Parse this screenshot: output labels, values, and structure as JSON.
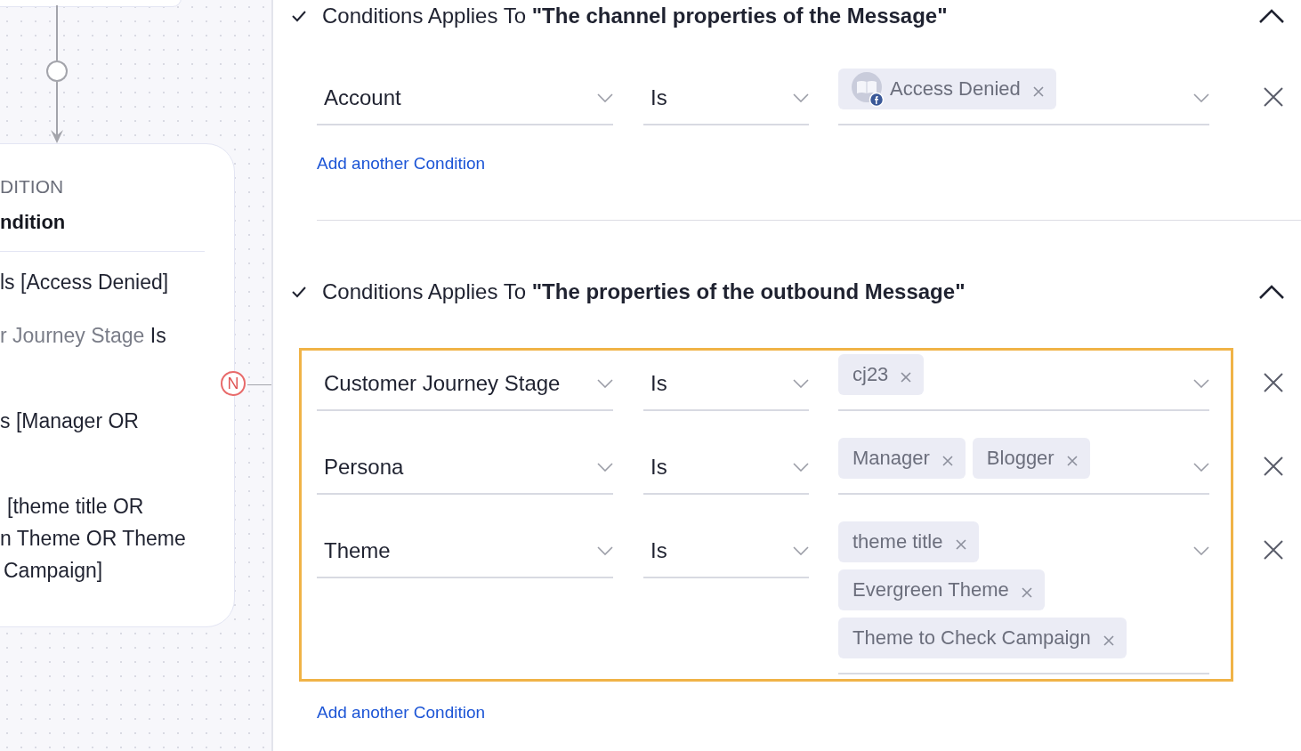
{
  "canvas": {
    "card": {
      "type_label": "DITION",
      "title": "ndition",
      "lines": [
        {
          "text": "ls [Access Denied]"
        },
        {
          "text": "r Journey Stage",
          "value": "Is"
        },
        {
          "text": "s [Manager OR"
        },
        {
          "text": "[theme title OR"
        },
        {
          "text": "n Theme OR Theme"
        },
        {
          "text": "Campaign]"
        }
      ]
    },
    "branch_badge": "N"
  },
  "sections": [
    {
      "title": "Conditions Applies To **\"The channel properties of the Message\"**",
      "expanded": true,
      "highlighted": false,
      "conditions": [
        {
          "field": "Account",
          "operator": "Is",
          "values": [
            {
              "label": "Access Denied",
              "kind": "account"
            }
          ]
        }
      ],
      "add_link": "Add another Condition"
    },
    {
      "title": "Conditions Applies To **\"The properties of the outbound Message\"**",
      "expanded": true,
      "highlighted": true,
      "conditions": [
        {
          "field": "Customer Journey Stage",
          "operator": "Is",
          "values": [
            {
              "label": "cj23",
              "kind": "tag"
            }
          ]
        },
        {
          "field": "Persona",
          "operator": "Is",
          "values": [
            {
              "label": "Manager",
              "kind": "tag"
            },
            {
              "label": "Blogger",
              "kind": "tag"
            }
          ]
        },
        {
          "field": "Theme",
          "operator": "Is",
          "values": [
            {
              "label": "theme title",
              "kind": "tag"
            },
            {
              "label": "Evergreen Theme",
              "kind": "tag"
            },
            {
              "label": "Theme to Check Campaign",
              "kind": "tag"
            }
          ]
        }
      ],
      "add_link": "Add another Condition"
    }
  ]
}
